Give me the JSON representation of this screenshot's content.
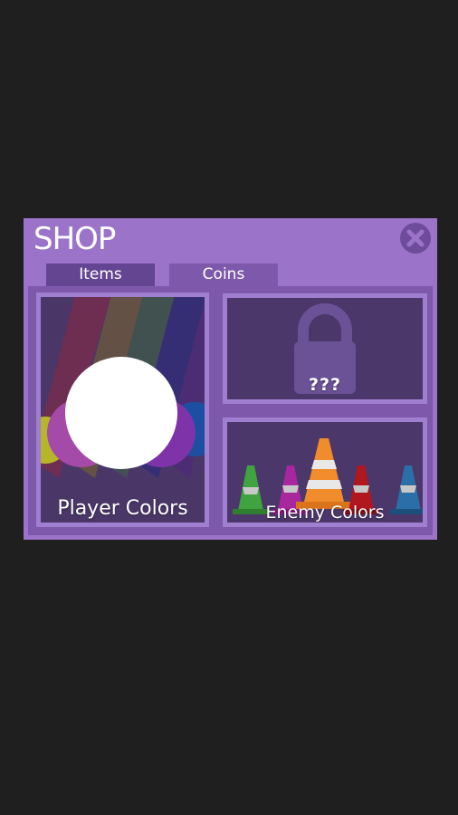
{
  "shop": {
    "title": "SHOP",
    "close_icon": "close-x-icon"
  },
  "tabs": [
    {
      "label": "Items",
      "selected": true
    },
    {
      "label": "Coins",
      "selected": false
    }
  ],
  "cards": {
    "player": {
      "label": "Player Colors",
      "icon": "player-ball-icon"
    },
    "locked": {
      "label": "???",
      "icon": "lock-icon"
    },
    "enemy": {
      "label": "Enemy Colors",
      "icon": "traffic-cone-icon"
    }
  },
  "colors": {
    "panel": "#9b73c9",
    "card_bg": "#4b3769",
    "accent_dark": "#6f4c9b",
    "background": "#1f1f1f"
  }
}
